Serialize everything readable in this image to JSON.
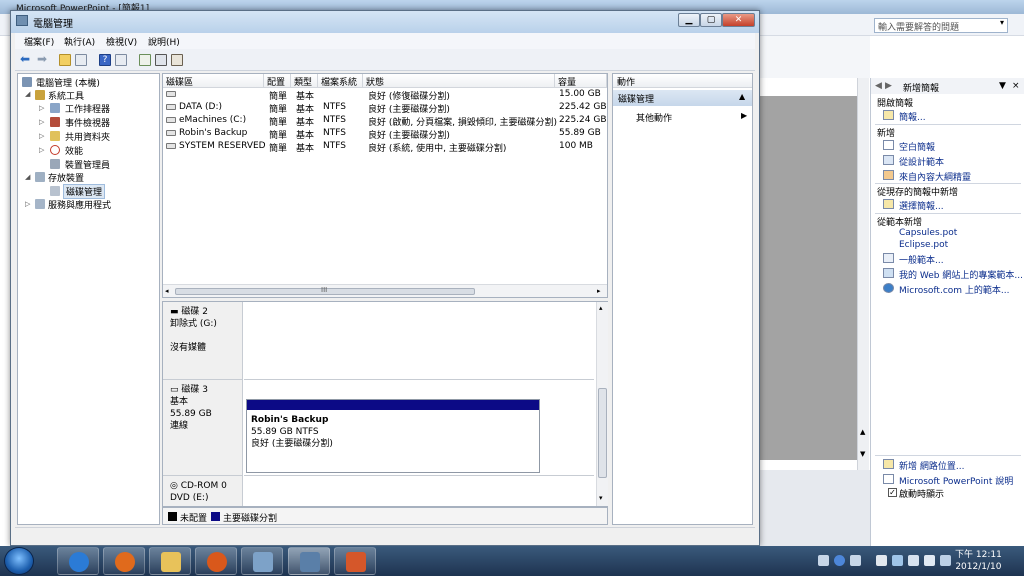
{
  "ppt": {
    "title": "Microsoft PowerPoint - [簡報1]",
    "help_placeholder": "輸入需要解答的問題"
  },
  "task_pane": {
    "title": "新增簡報",
    "sections": [
      {
        "heading": "開啟簡報",
        "links": [
          "簡報..."
        ]
      },
      {
        "heading": "新增",
        "links": [
          "空白簡報",
          "從設計範本",
          "來自內容大綱精靈"
        ]
      },
      {
        "heading": "從現存的簡報中新增",
        "links": [
          "選擇簡報..."
        ]
      },
      {
        "heading": "從範本新增",
        "links": [
          "Capsules.pot",
          "Eclipse.pot",
          "一般範本...",
          "我的 Web 網站上的專案範本...",
          "Microsoft.com 上的範本..."
        ]
      }
    ],
    "footer_links": [
      "新增 網路位置...",
      "Microsoft PowerPoint 說明"
    ],
    "startup_checkbox": {
      "label": "啟動時顯示",
      "checked": true
    }
  },
  "cm": {
    "title": "電腦管理",
    "menu": [
      "檔案(F)",
      "執行(A)",
      "檢視(V)",
      "說明(H)"
    ],
    "tree": {
      "root": "電腦管理 (本機)",
      "system_tools": "系統工具",
      "system_children": [
        "工作排程器",
        "事件檢視器",
        "共用資料夾",
        "效能",
        "裝置管理員"
      ],
      "storage": "存放裝置",
      "storage_children": [
        "磁碟管理"
      ],
      "services": "服務與應用程式"
    },
    "columns": [
      "磁碟區",
      "配置",
      "類型",
      "檔案系統",
      "狀態",
      "容量"
    ],
    "volumes": [
      {
        "name": "",
        "layout": "簡單",
        "type": "基本",
        "fs": "",
        "status": "良好 (修復磁碟分割)",
        "capacity": "15.00 GB"
      },
      {
        "name": "DATA (D:)",
        "layout": "簡單",
        "type": "基本",
        "fs": "NTFS",
        "status": "良好 (主要磁碟分割)",
        "capacity": "225.42 GB"
      },
      {
        "name": "eMachines (C:)",
        "layout": "簡單",
        "type": "基本",
        "fs": "NTFS",
        "status": "良好 (啟動, 分頁檔案, 損毀傾印, 主要磁碟分割)",
        "capacity": "225.24 GB"
      },
      {
        "name": "Robin's Backup",
        "layout": "簡單",
        "type": "基本",
        "fs": "NTFS",
        "status": "良好 (主要磁碟分割)",
        "capacity": "55.89 GB"
      },
      {
        "name": "SYSTEM RESERVED",
        "layout": "簡單",
        "type": "基本",
        "fs": "NTFS",
        "status": "良好 (系統, 使用中, 主要磁碟分割)",
        "capacity": "100 MB"
      }
    ],
    "scroll_grip": "III",
    "disks": [
      {
        "name": "磁碟 2",
        "line2": "卸除式 (G:)",
        "line3": "",
        "line4": "沒有媒體"
      },
      {
        "name": "磁碟 3",
        "line2": "基本",
        "line3": "55.89 GB",
        "line4": "連線"
      },
      {
        "name": "CD-ROM 0",
        "line2": "DVD (E:)",
        "line3": "",
        "line4": ""
      }
    ],
    "partition": {
      "name": "Robin's Backup",
      "size": "55.89 GB NTFS",
      "status": "良好 (主要磁碟分割)"
    },
    "legend": [
      {
        "label": "未配置",
        "color": "#000000"
      },
      {
        "label": "主要磁碟分割",
        "color": "#0c0a86"
      }
    ],
    "actions": {
      "header": "動作",
      "section": "磁碟管理",
      "more": "其他動作"
    }
  },
  "clock": {
    "time": "下午 12:11",
    "date": "2012/1/10"
  }
}
